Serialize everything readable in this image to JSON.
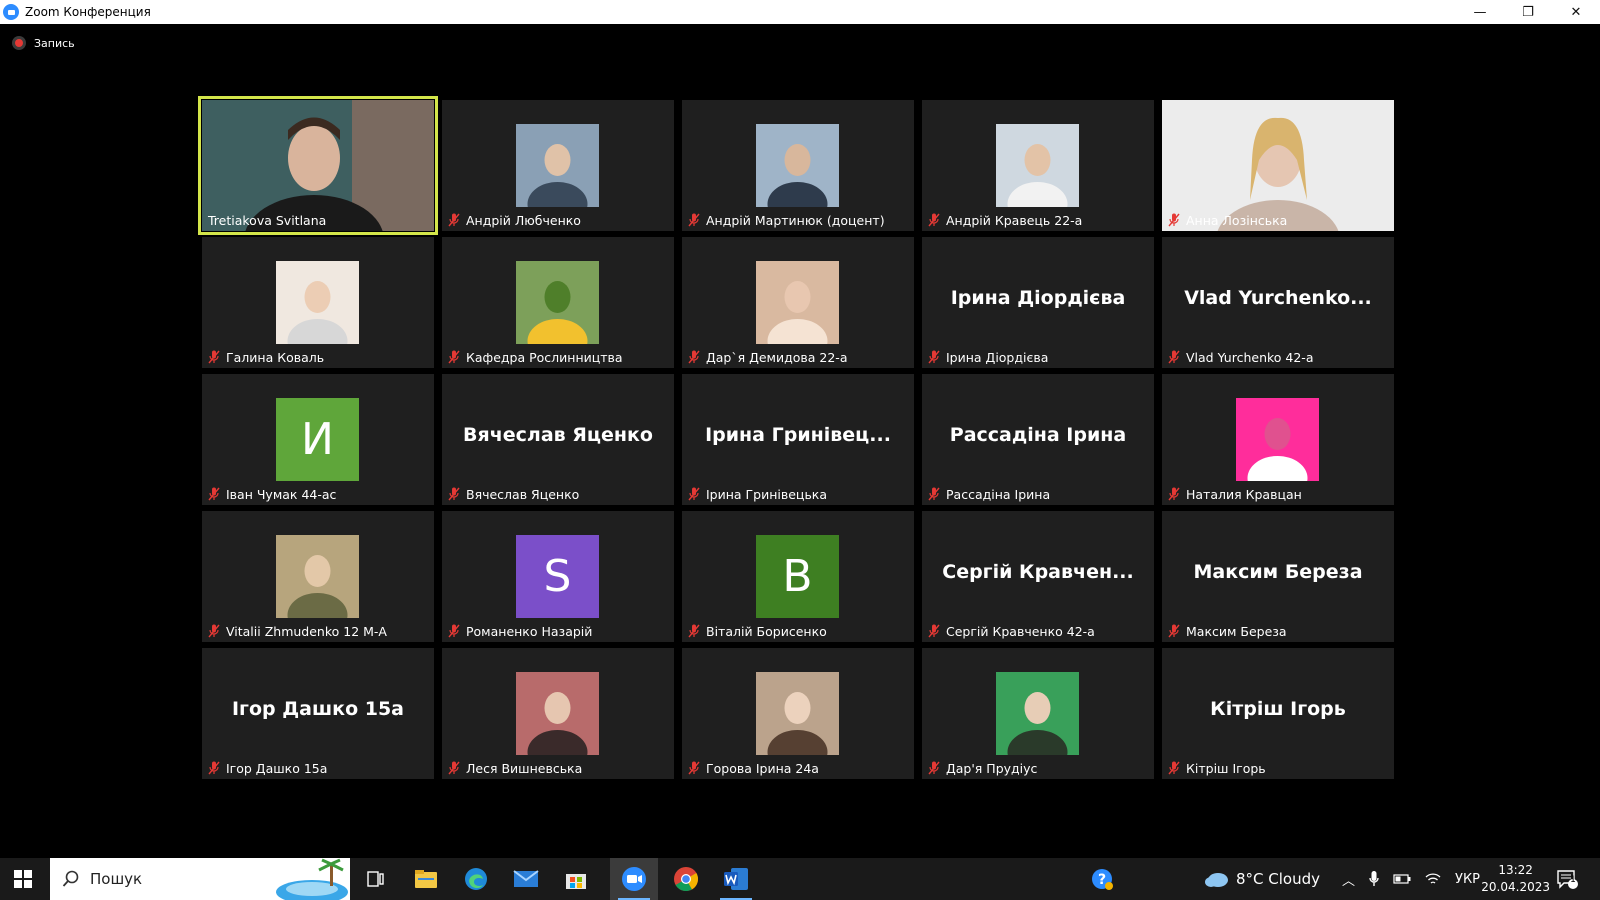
{
  "window": {
    "title": "Zoom Конференция",
    "controls": [
      "—",
      "❐",
      "✕"
    ]
  },
  "recording": {
    "label": "Запись"
  },
  "colors": {
    "accent": "#d4e64a",
    "mic_muted": "#e53935",
    "tile_bg": "#1f1f1f",
    "initial_green": "#5fa63a",
    "initial_purple": "#7b4fc9",
    "initial_darkgreen": "#3e7f22"
  },
  "participants": [
    {
      "name": "Tretiakova Svitlana",
      "type": "video",
      "active": true,
      "muted": false
    },
    {
      "name": "Андрій Любченко",
      "type": "photo",
      "muted": true
    },
    {
      "name": "Андрій Мартинюк (доцент)",
      "type": "photo",
      "muted": true
    },
    {
      "name": "Андрій Кравець 22-а",
      "type": "photo",
      "muted": true
    },
    {
      "name": "Анна Лозінська",
      "type": "video",
      "muted": true
    },
    {
      "name": "Галина  Коваль",
      "type": "photo",
      "muted": true
    },
    {
      "name": "Кафедра Рослинництва",
      "type": "photo",
      "muted": true
    },
    {
      "name": "Дар`я  Демидова 22-а",
      "type": "photo",
      "muted": true
    },
    {
      "name": "Ірина Діордієва",
      "type": "text",
      "display": "Ірина Діордієва",
      "muted": true
    },
    {
      "name": "Vlad Yurchenko 42-а",
      "type": "text",
      "display": "Vlad Yurchenko...",
      "muted": true
    },
    {
      "name": "Іван Чумак 44-ас",
      "type": "initial",
      "initial": "И",
      "muted": true
    },
    {
      "name": "Вячеслав Яценко",
      "type": "text",
      "display": "Вячеслав Яценко",
      "muted": true
    },
    {
      "name": "Ірина Гринівецька",
      "type": "text",
      "display": "Ірина Гринівец...",
      "muted": true
    },
    {
      "name": "Рассадіна Ірина",
      "type": "text",
      "display": "Рассадіна Ірина",
      "muted": true
    },
    {
      "name": "Наталия Кравцан",
      "type": "photo",
      "muted": true
    },
    {
      "name": "Vitalii Zhmudenko 12 М-А",
      "type": "photo",
      "muted": true
    },
    {
      "name": "Романенко Назарій",
      "type": "initial",
      "initial": "S",
      "muted": true
    },
    {
      "name": "Віталій Борисенко",
      "type": "initial",
      "initial": "B",
      "muted": true
    },
    {
      "name": "Сергій Кравченко 42-а",
      "type": "text",
      "display": "Сергій Кравчен...",
      "muted": true
    },
    {
      "name": "Максим Береза",
      "type": "text",
      "display": "Максим Береза",
      "muted": true
    },
    {
      "name": "Ігор Дашко 15а",
      "type": "text",
      "display": "Ігор Дашко 15а",
      "muted": true
    },
    {
      "name": "Леся Вишневська",
      "type": "photo",
      "muted": true
    },
    {
      "name": "Горова Ірина 24а",
      "type": "photo",
      "muted": true
    },
    {
      "name": "Дар'я Прудіус",
      "type": "photo",
      "muted": true
    },
    {
      "name": "Кітріш Ігорь",
      "type": "text",
      "display": "Кітріш Ігорь",
      "muted": true
    }
  ],
  "taskbar": {
    "search_placeholder": "Пошук",
    "apps": [
      "task-view",
      "file-explorer",
      "edge",
      "mail",
      "store",
      "zoom",
      "chrome",
      "word"
    ],
    "active_app": "zoom",
    "weather": "8°C  Cloudy",
    "language": "УКР",
    "time": "13:22",
    "date": "20.04.2023",
    "notifications": "1"
  }
}
